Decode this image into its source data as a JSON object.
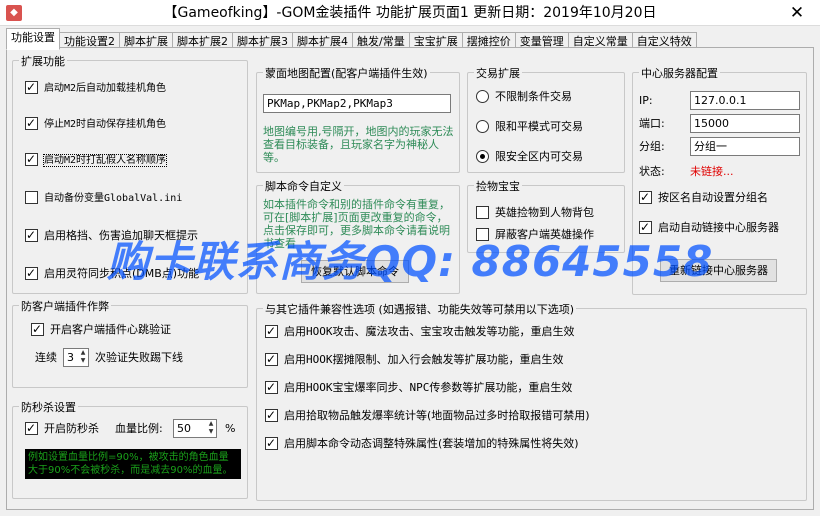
{
  "window": {
    "title": "【Gameofking】-GOM金装插件 功能扩展页面1    更新日期：2019年10月20日",
    "close": "✕"
  },
  "tabs": [
    "功能设置",
    "功能设置2",
    "脚本扩展",
    "脚本扩展2",
    "脚本扩展3",
    "脚本扩展4",
    "触发/常量",
    "宝宝扩展",
    "摆摊控价",
    "变量管理",
    "自定义常量",
    "自定义特效"
  ],
  "expand": {
    "legend": "扩展功能",
    "items": [
      {
        "label": "启动M2后自动加载挂机角色",
        "checked": true
      },
      {
        "label": "停止M2时自动保存挂机角色",
        "checked": true
      },
      {
        "label": "启动M2时打乱假人名称顺序",
        "checked": true
      },
      {
        "label": "自动备份变量GlobalVal.ini",
        "checked": false
      },
      {
        "label": "启用格挡、伤害追加聊天框提示",
        "checked": true
      },
      {
        "label": "启用灵符同步积点(DMB点)功能",
        "checked": true
      }
    ]
  },
  "map_config": {
    "legend": "蒙面地图配置(配客户端插件生效)",
    "value": "PKMap,PKMap2,PKMap3",
    "note": "地图编号用,号隔开，地图内的玩家无法查看目标装备，且玩家名字为神秘人等。"
  },
  "script_cmd": {
    "legend": "脚本命令自定义",
    "note": "如本插件命令和别的插件命令有重复，可在[脚本扩展]页面更改重复的命令，点击保存即可，更多脚本命令请看说明书查看",
    "button": "恢复默认脚本命令"
  },
  "trade": {
    "legend": "交易扩展",
    "options": [
      {
        "label": "不限制条件交易",
        "selected": false
      },
      {
        "label": "限和平模式可交易",
        "selected": false
      },
      {
        "label": "限安全区内可交易",
        "selected": true
      }
    ]
  },
  "pickup": {
    "legend": "捡物宝宝",
    "items": [
      {
        "label": "英雄捡物到人物背包",
        "checked": false
      },
      {
        "label": "屏蔽客户端英雄操作",
        "checked": false
      }
    ]
  },
  "server": {
    "legend": "中心服务器配置",
    "ip_label": "IP:",
    "ip": "127.0.0.1",
    "port_label": "端口:",
    "port": "15000",
    "group_label": "分组:",
    "group": "分组一",
    "status_label": "状态:",
    "status": "未链接...",
    "items": [
      {
        "label": "按区名自动设置分组名",
        "checked": true
      },
      {
        "label": "启动自动链接中心服务器",
        "checked": true
      }
    ],
    "button": "重新链接中心服务器"
  },
  "anticlient": {
    "legend": "防客户端插件作弊",
    "heartbeat": {
      "label": "开启客户端插件心跳验证",
      "checked": true
    },
    "prefix": "连续",
    "count": "3",
    "suffix": "次验证失败踢下线"
  },
  "antikill": {
    "legend": "防秒杀设置",
    "enable": {
      "label": "开启防秒杀",
      "checked": true
    },
    "ratio_label": "血量比例:",
    "ratio": "50",
    "unit": "%",
    "note": "例如设置血量比例=90%，被攻击的角色血量大于90%不会被秒杀，而是减去90%的血量。"
  },
  "compat": {
    "legend": "与其它插件兼容性选项 (如遇报错、功能失效等可禁用以下选项)",
    "items": [
      {
        "label": "启用HOOK攻击、魔法攻击、宝宝攻击触发等功能，重启生效",
        "checked": true
      },
      {
        "label": "启用HOOK摆摊限制、加入行会触发等扩展功能，重启生效",
        "checked": true
      },
      {
        "label": "启用HOOK宝宝爆率同步、NPC传参数等扩展功能，重启生效",
        "checked": true
      },
      {
        "label": "启用拾取物品触发爆率统计等(地面物品过多时拾取报错可禁用)",
        "checked": true
      },
      {
        "label": "启用脚本命令动态调整特殊属性(套装增加的特殊属性将失效)",
        "checked": true
      }
    ]
  },
  "watermark": "购卡联系商务QQ: 88645558"
}
